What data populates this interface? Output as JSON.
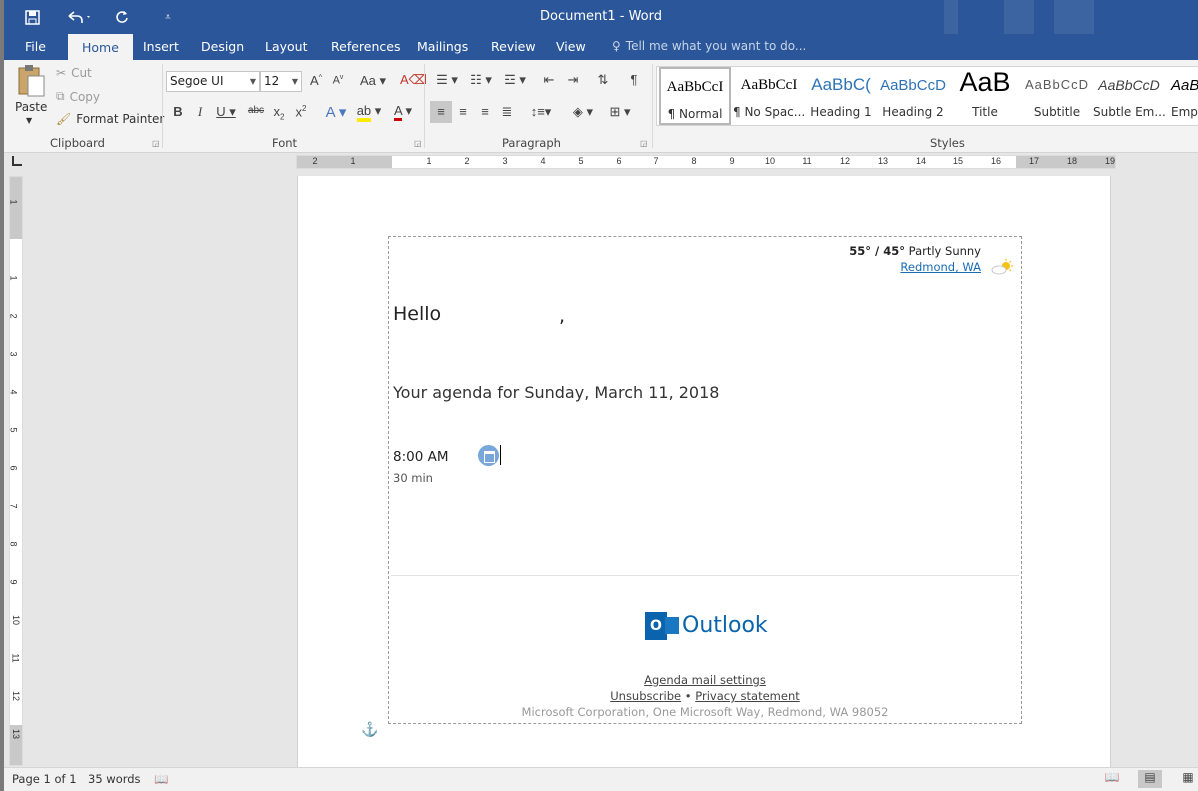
{
  "window": {
    "title": "Document1 - Word"
  },
  "quick_access": {
    "save_icon": "save-icon",
    "undo_icon": "undo-icon",
    "redo_icon": "redo-icon",
    "customize_icon": "customize-icon"
  },
  "tabs": [
    {
      "label": "File"
    },
    {
      "label": "Home"
    },
    {
      "label": "Insert"
    },
    {
      "label": "Design"
    },
    {
      "label": "Layout"
    },
    {
      "label": "References"
    },
    {
      "label": "Mailings"
    },
    {
      "label": "Review"
    },
    {
      "label": "View"
    }
  ],
  "tell_me": "Tell me what you want to do...",
  "clipboard": {
    "paste": "Paste",
    "cut": "Cut",
    "copy": "Copy",
    "format_painter": "Format Painter",
    "label": "Clipboard"
  },
  "font": {
    "family": "Segoe UI",
    "size": "12",
    "label": "Font"
  },
  "paragraph": {
    "label": "Paragraph"
  },
  "styles": {
    "label": "Styles",
    "items": [
      {
        "sample": "AaBbCcI",
        "name": "¶ Normal"
      },
      {
        "sample": "AaBbCcI",
        "name": "¶ No Spac..."
      },
      {
        "sample": "AaBbC(",
        "name": "Heading 1"
      },
      {
        "sample": "AaBbCcD",
        "name": "Heading 2"
      },
      {
        "sample": "AaB",
        "name": "Title"
      },
      {
        "sample": "AaBbCcD",
        "name": "Subtitle"
      },
      {
        "sample": "AaBbCcD",
        "name": "Subtle Em..."
      },
      {
        "sample": "AaBb",
        "name": "Empl"
      }
    ]
  },
  "ruler": {
    "h_numbers": [
      "2",
      "1",
      "1",
      "2",
      "3",
      "4",
      "5",
      "6",
      "7",
      "8",
      "9",
      "10",
      "11",
      "12",
      "13",
      "14",
      "15",
      "16",
      "17",
      "18",
      "19"
    ],
    "v_numbers": [
      "1",
      "1",
      "2",
      "3",
      "4",
      "5",
      "6",
      "7",
      "8",
      "9",
      "10",
      "11",
      "12",
      "13"
    ]
  },
  "document": {
    "weather_temp": "55° / 45°",
    "weather_desc": "Partly Sunny",
    "location": "Redmond, WA",
    "greeting": "Hello",
    "comma": ",",
    "agenda_title": "Your agenda for Sunday, March 11, 2018",
    "event_time": "8:00 AM",
    "event_duration": "30 min",
    "outlook_brand": "Outlook",
    "outlook_logo_letter": "O",
    "agenda_settings": "Agenda mail settings",
    "unsubscribe": "Unsubscribe",
    "bullet": "•",
    "privacy": "Privacy statement",
    "corporation": "Microsoft Corporation, One Microsoft Way, Redmond, WA 98052"
  },
  "status": {
    "page": "Page 1 of 1",
    "words": "35 words"
  },
  "colors": {
    "word_blue": "#2b579a",
    "outlook_blue": "#0a64ad",
    "link": "#1a6bb5"
  }
}
